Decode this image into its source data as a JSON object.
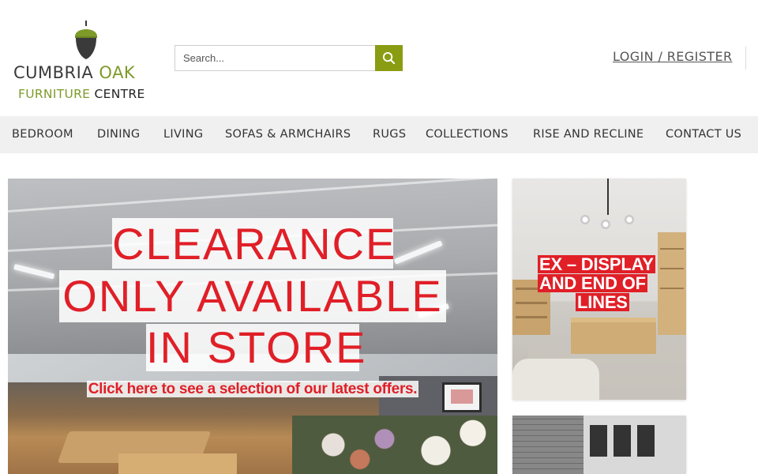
{
  "brand": {
    "name_top_1": "CUMBRIA",
    "name_top_2": "OAK",
    "name_bottom_1": "FURNITURE",
    "name_bottom_2": "CENTRE",
    "icon": "acorn-logo-icon",
    "accent_color": "#7e9b2a"
  },
  "search": {
    "placeholder": "Search...",
    "value": "",
    "button_icon": "search-icon",
    "button_color": "#8a9c12"
  },
  "account": {
    "login_label": "LOGIN / REGISTER"
  },
  "nav": {
    "items": [
      {
        "label": "BEDROOM"
      },
      {
        "label": "DINING"
      },
      {
        "label": "LIVING"
      },
      {
        "label": "SOFAS & ARMCHAIRS"
      },
      {
        "label": "RUGS"
      },
      {
        "label": "COLLECTIONS"
      },
      {
        "label": "RISE AND RECLINE"
      },
      {
        "label": "CONTACT US"
      }
    ]
  },
  "hero": {
    "line1": "CLEARANCE",
    "line2": "ONLY AVAILABLE",
    "line3": "IN STORE",
    "link_text": "Click here to see a selection of our latest offers.",
    "text_color": "#e01f27"
  },
  "promos": {
    "display": {
      "line1": "EX – DISPLAY",
      "line2": "AND END OF",
      "line3": "LINES"
    }
  }
}
